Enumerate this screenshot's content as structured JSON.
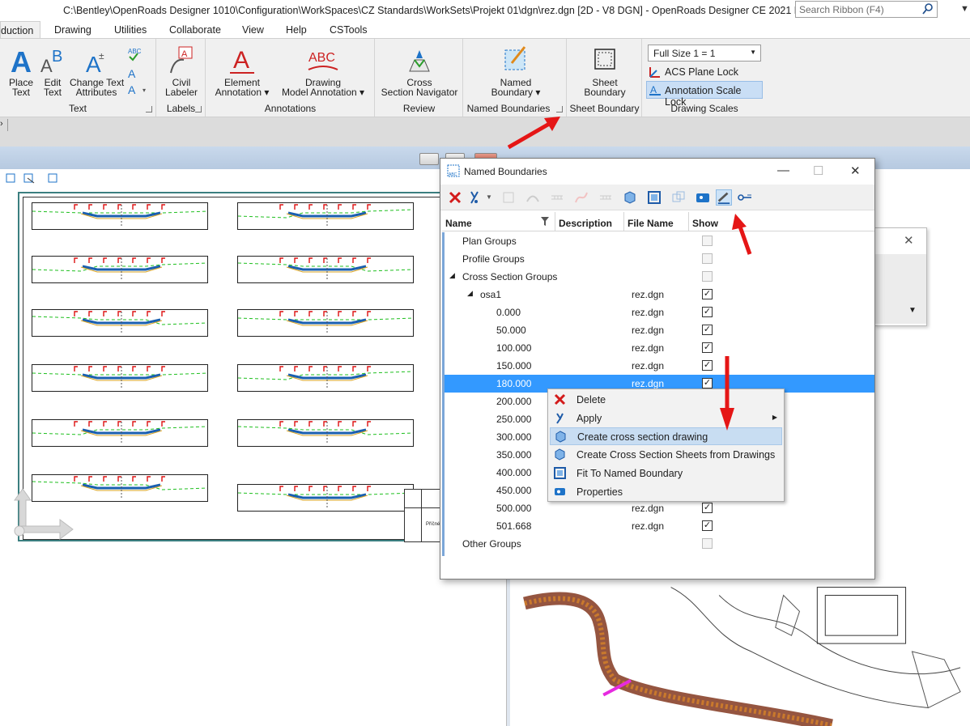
{
  "window": {
    "title": "C:\\Bentley\\OpenRoads Designer 1010\\Configuration\\WorkSpaces\\CZ Standards\\WorkSets\\Projekt 01\\dgn\\rez.dgn [2D - V8 DGN] - OpenRoads Designer CE 2021 Release 2",
    "search_placeholder": "Search Ribbon (F4)"
  },
  "tabs": [
    "duction",
    "Drawing",
    "Utilities",
    "Collaborate",
    "View",
    "Help",
    "CSTools"
  ],
  "ribbon": {
    "text_group": {
      "label": "Text",
      "place_text": [
        "Place",
        "Text"
      ],
      "edit_text": [
        "Edit",
        "Text"
      ],
      "change_attr": [
        "Change Text",
        "Attributes"
      ]
    },
    "labels_group": {
      "label": "Labels",
      "civil_labeler": [
        "Civil",
        "Labeler"
      ]
    },
    "annotations_group": {
      "label": "Annotations",
      "element_annotation": [
        "Element",
        "Annotation"
      ],
      "drawing_model_annotation": [
        "Drawing",
        "Model Annotation"
      ]
    },
    "review_group": {
      "label": "Review",
      "cross_section_navigator": [
        "Cross",
        "Section Navigator"
      ]
    },
    "named_boundaries_group": {
      "label": "Named Boundaries",
      "named_boundary": [
        "Named",
        "Boundary"
      ]
    },
    "sheet_boundary_group": {
      "label": "Sheet Boundary",
      "sheet_boundary": [
        "Sheet",
        "Boundary"
      ]
    },
    "drawing_scales_group": {
      "label": "Drawing Scales",
      "scale_value": "Full Size 1 = 1",
      "acs_plane_lock": "ACS Plane Lock",
      "annotation_scale_lock": "Annotation Scale Lock"
    }
  },
  "dialog": {
    "title": "Named Boundaries",
    "columns": {
      "name": "Name",
      "description": "Description",
      "file_name": "File Name",
      "show": "Show"
    },
    "rows": [
      {
        "name": "Plan Groups",
        "file": "",
        "show": false
      },
      {
        "name": "Profile Groups",
        "file": "",
        "show": false
      },
      {
        "name": "Cross Section Groups",
        "file": "",
        "show": false
      },
      {
        "name": "osa1",
        "file": "rez.dgn",
        "show": true
      },
      {
        "name": "0.000",
        "file": "rez.dgn",
        "show": true
      },
      {
        "name": "50.000",
        "file": "rez.dgn",
        "show": true
      },
      {
        "name": "100.000",
        "file": "rez.dgn",
        "show": true
      },
      {
        "name": "150.000",
        "file": "rez.dgn",
        "show": true
      },
      {
        "name": "180.000",
        "file": "rez.dgn",
        "show": true
      },
      {
        "name": "200.000",
        "file": "",
        "show": true
      },
      {
        "name": "250.000",
        "file": "",
        "show": true
      },
      {
        "name": "300.000",
        "file": "",
        "show": true
      },
      {
        "name": "350.000",
        "file": "",
        "show": true
      },
      {
        "name": "400.000",
        "file": "",
        "show": true
      },
      {
        "name": "450.000",
        "file": "",
        "show": true
      },
      {
        "name": "500.000",
        "file": "rez.dgn",
        "show": true
      },
      {
        "name": "501.668",
        "file": "rez.dgn",
        "show": true
      },
      {
        "name": "Other Groups",
        "file": "",
        "show": false
      }
    ]
  },
  "context_menu": {
    "items": [
      {
        "label": "Delete",
        "icon": "red-x-icon"
      },
      {
        "label": "Apply",
        "icon": "apply-icon",
        "submenu": true
      },
      {
        "label": "Create cross section drawing",
        "icon": "cross-section-drawing-icon"
      },
      {
        "label": "Create Cross Section Sheets from Drawings",
        "icon": "cross-section-sheets-icon"
      },
      {
        "label": "Fit To Named Boundary",
        "icon": "fit-icon"
      },
      {
        "label": "Properties",
        "icon": "properties-icon"
      }
    ]
  },
  "sheet": {
    "title_block_text": "Příčné řezy"
  },
  "colors": {
    "accent": "#3399ff",
    "arrow": "#e51616",
    "sheet_border": "#3b7f80"
  }
}
